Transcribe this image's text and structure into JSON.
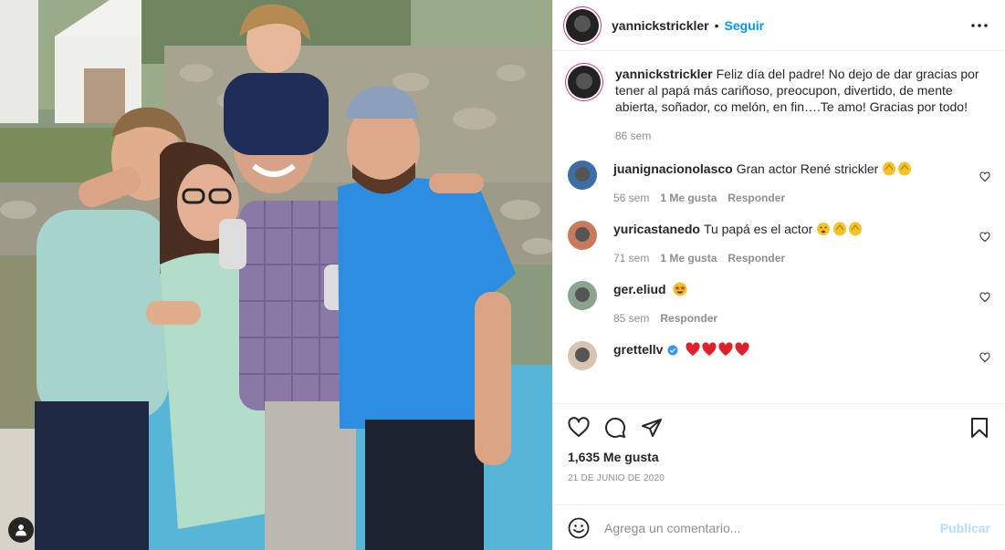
{
  "post": {
    "author": "yannickstrickler",
    "follow_label": "Seguir",
    "separator": "•",
    "more_icon": "more-horizontal-icon"
  },
  "caption": {
    "username": "yannickstrickler",
    "text": "Feliz día del padre! No dejo de dar gracias por tener al papá más cariñoso, preocupon, divertido, de mente abierta, soñador, co melón, en fin….Te amo! Gracias por todo!",
    "time": "86 sem"
  },
  "comments": [
    {
      "username": "juanignacionolasco",
      "text": "Gran actor René strickler",
      "emoji": "clap-clap",
      "time": "56 sem",
      "likes": "1 Me gusta",
      "reply": "Responder"
    },
    {
      "username": "yuricastanedo",
      "text": "Tu papá es el actor",
      "emoji": "face-clap-clap",
      "time": "71 sem",
      "likes": "1 Me gusta",
      "reply": "Responder"
    },
    {
      "username": "ger.eliud",
      "text": "",
      "emoji": "star-struck",
      "time": "85 sem",
      "likes": "",
      "reply": "Responder"
    },
    {
      "username": "grettellv",
      "text": "",
      "emoji": "four-red-hearts",
      "verified": true
    }
  ],
  "actions": {
    "like_icon": "heart-icon",
    "comment_icon": "comment-icon",
    "share_icon": "share-icon",
    "save_icon": "bookmark-icon",
    "likes_count": "1,635 Me gusta",
    "date": "21 DE JUNIO DE 2020"
  },
  "add_comment": {
    "placeholder": "Agrega un comentario...",
    "publish_label": "Publicar"
  },
  "colors": {
    "accent": "#0095f6",
    "publish_disabled": "#b2dffc",
    "muted": "#8e8e8e",
    "text": "#262626",
    "heart_red": "#ed4956",
    "verified_blue": "#3897f0"
  }
}
